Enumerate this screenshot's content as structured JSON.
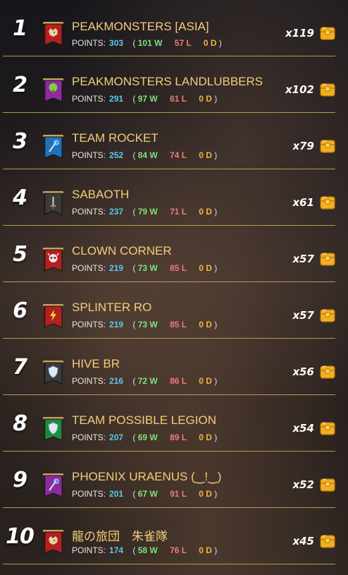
{
  "leaderboard": {
    "rows": [
      {
        "rank": "1",
        "name": "PEAKMONSTERS [ASIA]",
        "points_label": "POINTS:",
        "points": "303",
        "wins": "101 W",
        "losses": "57 L",
        "draws": "0 D",
        "multiplier": "x119",
        "banner_color": "#b32020",
        "emblem": "wolf-icon"
      },
      {
        "rank": "2",
        "name": "PEAKMONSTERS LANDLUBBERS",
        "points_label": "POINTS:",
        "points": "291",
        "wins": "97 W",
        "losses": "61 L",
        "draws": "0 D",
        "multiplier": "x102",
        "banner_color": "#8e2aa0",
        "emblem": "tree-icon"
      },
      {
        "rank": "3",
        "name": "TEAM ROCKET",
        "points_label": "POINTS:",
        "points": "252",
        "wins": "84 W",
        "losses": "74 L",
        "draws": "0 D",
        "multiplier": "x79",
        "banner_color": "#1f72b8",
        "emblem": "staff-icon"
      },
      {
        "rank": "4",
        "name": "SABAOTH",
        "points_label": "POINTS:",
        "points": "237",
        "wins": "79 W",
        "losses": "71 L",
        "draws": "0 D",
        "multiplier": "x61",
        "banner_color": "#3a3a3a",
        "emblem": "sword-icon"
      },
      {
        "rank": "5",
        "name": "CLOWN CORNER",
        "points_label": "POINTS:",
        "points": "219",
        "wins": "73 W",
        "losses": "85 L",
        "draws": "0 D",
        "multiplier": "x57",
        "banner_color": "#b32020",
        "emblem": "skull-icon"
      },
      {
        "rank": "6",
        "name": "SPLINTER RO",
        "points_label": "POINTS:",
        "points": "219",
        "wins": "73 W",
        "losses": "85 L",
        "draws": "0 D",
        "multiplier": "x57",
        "banner_color": "#b32020",
        "emblem": "lightning-icon"
      },
      {
        "rank": "7",
        "name": "HIVE BR",
        "points_label": "POINTS:",
        "points": "216",
        "wins": "72 W",
        "losses": "86 L",
        "draws": "0 D",
        "multiplier": "x56",
        "banner_color": "#3a3a3a",
        "emblem": "shield-icon"
      },
      {
        "rank": "8",
        "name": "TEAM POSSIBLE LEGION",
        "points_label": "POINTS:",
        "points": "207",
        "wins": "69 W",
        "losses": "89 L",
        "draws": "0 D",
        "multiplier": "x54",
        "banner_color": "#1f8a3a",
        "emblem": "shield-icon"
      },
      {
        "rank": "9",
        "name": "PHOENIX URAENUS (‿!‿)",
        "points_label": "POINTS:",
        "points": "201",
        "wins": "67 W",
        "losses": "91 L",
        "draws": "0 D",
        "multiplier": "x52",
        "banner_color": "#8e2aa0",
        "emblem": "staff-icon"
      },
      {
        "rank": "10",
        "name": "龍の旅団　朱雀隊",
        "points_label": "POINTS:",
        "points": "174",
        "wins": "58 W",
        "losses": "76 L",
        "draws": "0 D",
        "multiplier": "x45",
        "banner_color": "#b32020",
        "emblem": "wolf-icon"
      }
    ],
    "colors": {
      "name": "#f3cd7a",
      "points": "#5ec6e8",
      "wins": "#7ee07a",
      "losses": "#f07a74",
      "draws": "#f0b440",
      "divider": "#c9a35a",
      "chest": "#f2b01e"
    }
  }
}
